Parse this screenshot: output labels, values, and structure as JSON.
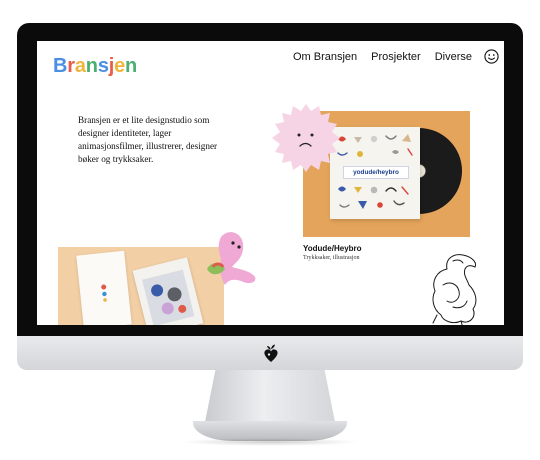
{
  "site": {
    "logo_letters": [
      {
        "char": "B",
        "color": "#4a8fe2"
      },
      {
        "char": "r",
        "color": "#e85d4a"
      },
      {
        "char": "a",
        "color": "#f2b53c"
      },
      {
        "char": "n",
        "color": "#4caf72"
      },
      {
        "char": "s",
        "color": "#4a8fe2"
      },
      {
        "char": "j",
        "color": "#e85d4a"
      },
      {
        "char": "e",
        "color": "#f2b53c"
      },
      {
        "char": "n",
        "color": "#4caf72"
      }
    ],
    "nav": {
      "about": "Om Bransjen",
      "projects": "Prosjekter",
      "misc": "Diverse",
      "smiley_icon": "smiley-face-icon"
    },
    "intro_text": "Bransjen er et lite designstudio som designer identiteter, lager animasjonsfilmer, illustrerer, designer bøker og trykksaker.",
    "projects": [
      {
        "title": "Yodude/Heybro",
        "subtitle": "Trykksaker, illustrasjon",
        "cover_text": "yodude/heybro",
        "bg_color": "#e4a45b"
      },
      {
        "bg_color": "#f3cfa5"
      }
    ]
  },
  "device": {
    "type": "desktop-monitor",
    "chin_icon": "heart-sprout-logo-icon"
  }
}
